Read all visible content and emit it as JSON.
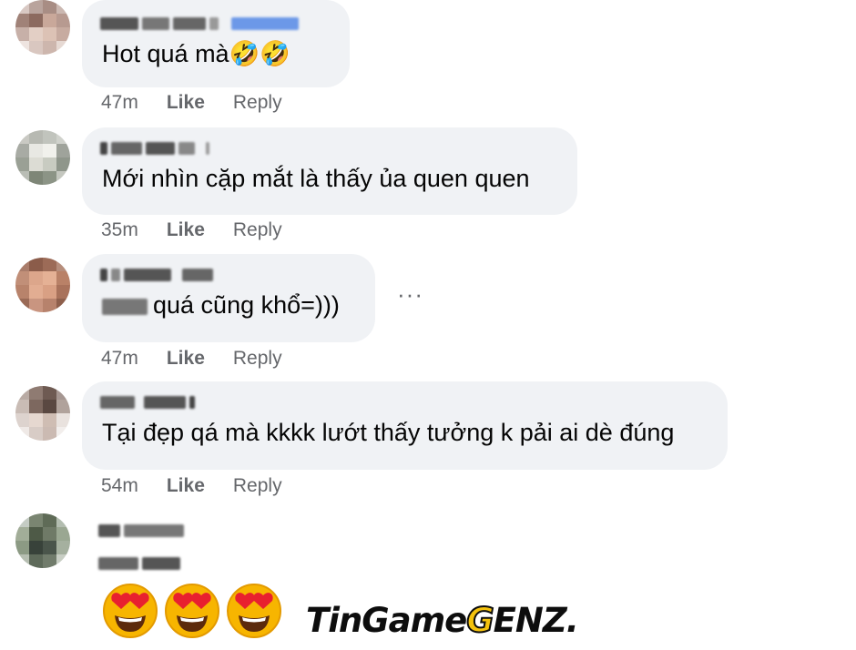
{
  "comments": [
    {
      "text": "Hot quá mà🤣🤣",
      "time": "47m",
      "like": "Like",
      "reply": "Reply"
    },
    {
      "text": "Mới nhìn cặp mắt là thấy ủa quen quen",
      "time": "35m",
      "like": "Like",
      "reply": "Reply"
    },
    {
      "text": "quá cũng khổ=)))",
      "time": "47m",
      "like": "Like",
      "reply": "Reply",
      "more": "···"
    },
    {
      "text": "Tại đẹp qá mà kkkk lướt thấy tưởng k pải ai dè đúng",
      "time": "54m",
      "like": "Like",
      "reply": "Reply"
    }
  ],
  "last_comment": {
    "emoji": [
      "😍",
      "😍",
      "😍"
    ]
  },
  "watermark": {
    "part1": "TinGame",
    "part2": "G",
    "part3": "ENZ."
  },
  "colors": {
    "bubble": "#f0f2f5",
    "meta": "#65676b",
    "text": "#050505",
    "follow_link": "#1877f2"
  }
}
